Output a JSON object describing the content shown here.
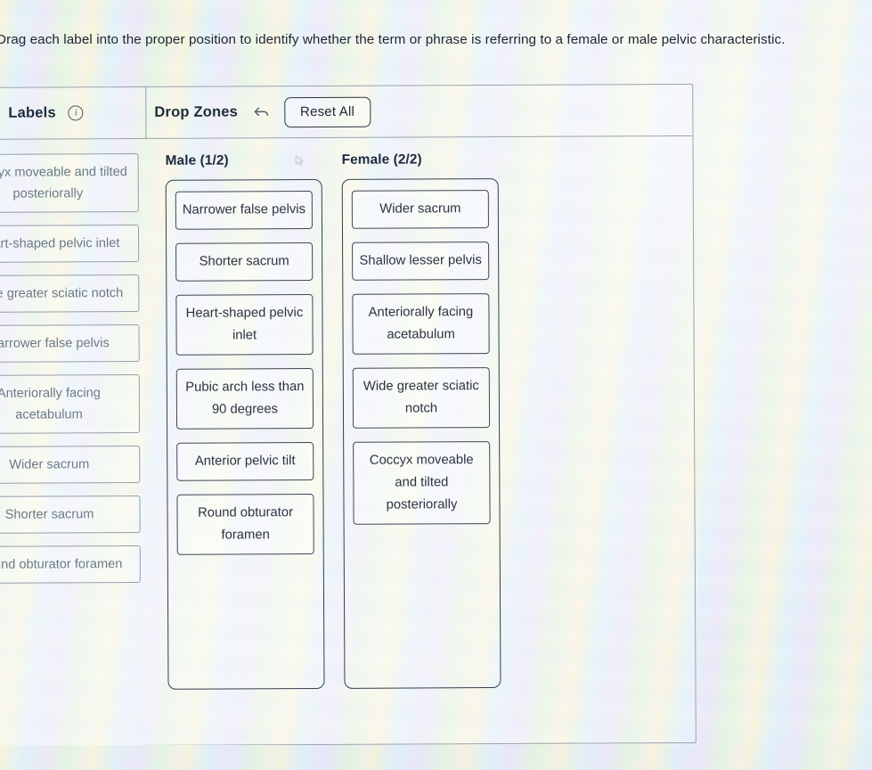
{
  "prompt": "Drag each label into the proper position to identify whether the term or phrase is referring to a female or male pelvic characteristic.",
  "header": {
    "labels_title": "Labels",
    "info_icon": "info-icon",
    "drop_zones_title": "Drop Zones",
    "undo_icon": "undo-arrow-icon",
    "reset_label": "Reset All"
  },
  "labels_bank": [
    {
      "text": "Coccyx moveable and tilted posteriorally"
    },
    {
      "text": "Heart-shaped pelvic inlet"
    },
    {
      "text": "Wide greater sciatic notch"
    },
    {
      "text": "Narrower false pelvis"
    },
    {
      "text": "Anteriorally facing acetabulum"
    },
    {
      "text": "Wider sacrum"
    },
    {
      "text": "Shorter sacrum"
    },
    {
      "text": "Round obturator foramen"
    }
  ],
  "zones": [
    {
      "title": "Male (1/2)",
      "cursor_icon": "pointer-cursor-icon",
      "items": [
        {
          "text": "Narrower false pelvis"
        },
        {
          "text": "Shorter sacrum"
        },
        {
          "text": "Heart-shaped pelvic inlet"
        },
        {
          "text": "Pubic arch less than 90 degrees"
        },
        {
          "text": "Anterior pelvic tilt"
        },
        {
          "text": "Round obturator foramen"
        }
      ]
    },
    {
      "title": "Female (2/2)",
      "cursor_icon": "",
      "items": [
        {
          "text": "Wider sacrum"
        },
        {
          "text": "Shallow lesser pelvis"
        },
        {
          "text": "Anteriorally facing acetabulum"
        },
        {
          "text": "Wide greater sciatic notch"
        },
        {
          "text": "Coccyx moveable and tilted posteriorally"
        }
      ]
    }
  ],
  "colors": {
    "text_dark": "#1d2a3a",
    "label_muted": "#61707e",
    "border_panel": "#9aa4ad",
    "border_zone": "#33404d"
  }
}
